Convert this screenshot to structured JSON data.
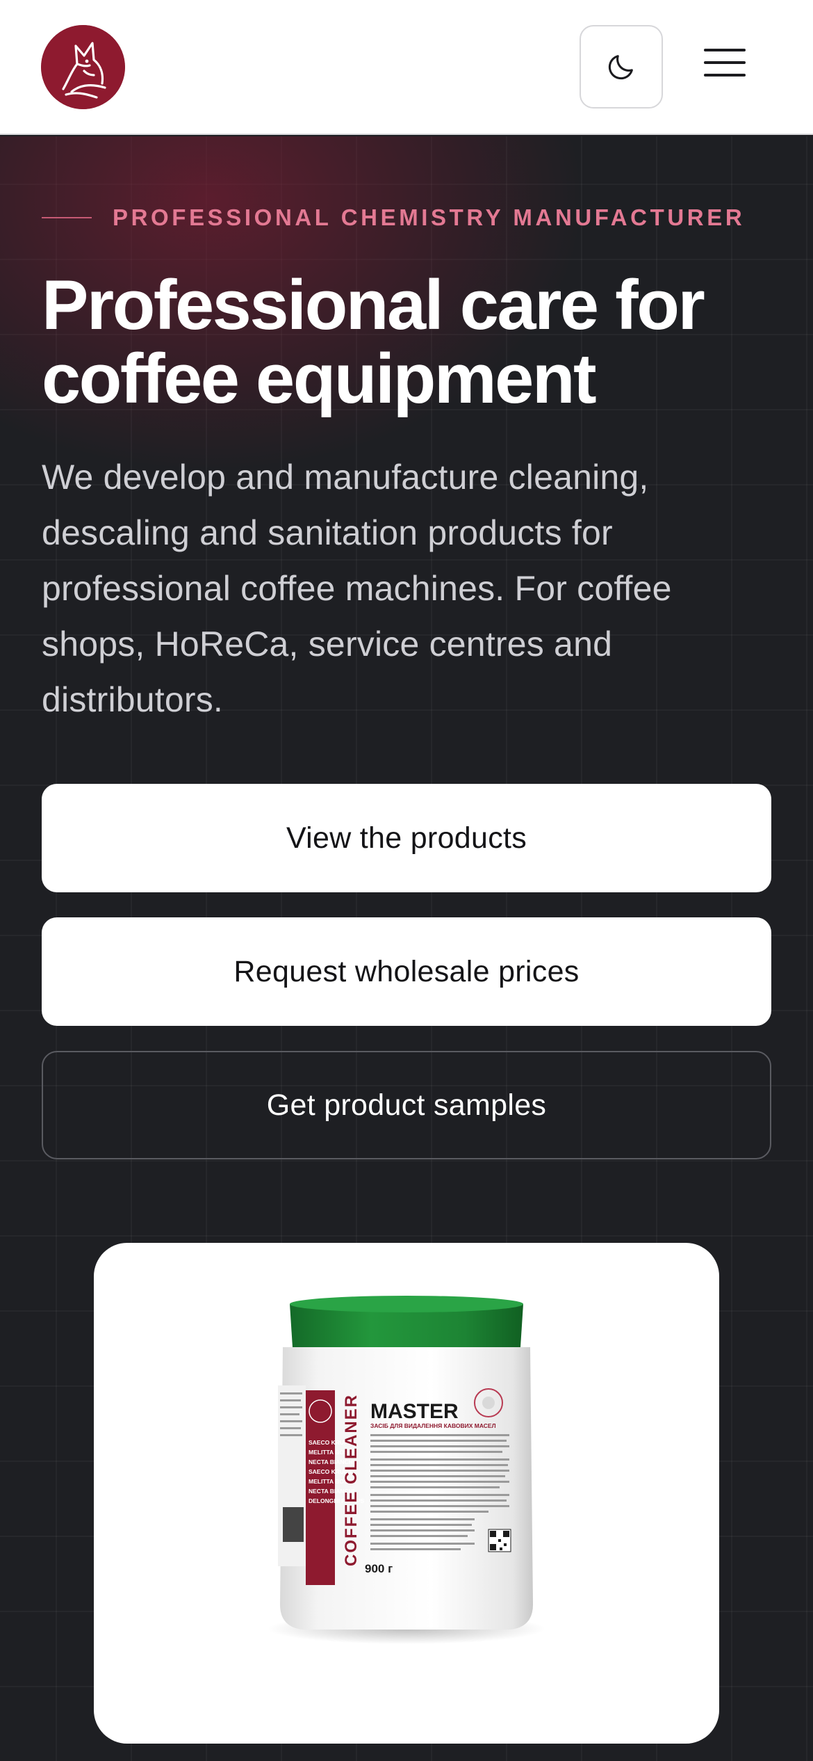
{
  "header": {
    "logo_icon": "fox-logo-icon",
    "theme_toggle_icon": "moon-icon",
    "menu_icon": "hamburger-menu-icon"
  },
  "hero": {
    "eyebrow": "PROFESSIONAL CHEMISTRY MANUFACTURER",
    "title_line1": "Professional care for",
    "title_line2": "coffee equipment",
    "lead": "We develop and manufacture cleaning, descaling and sanitation products for professional coffee machines. For coffee shops, HoReCa, service centres and distributors.",
    "buttons": {
      "view_products": "View the products",
      "wholesale": "Request wholesale prices",
      "samples": "Get product samples"
    }
  },
  "product": {
    "brand": "MASTER",
    "subtitle": "ЗАСІБ ДЛЯ ВИДАЛЕННЯ КАВОВИХ МАСЕЛ",
    "side_label": "COFFEE CLEANER",
    "weight": "900 г",
    "compat_list": [
      "SAECO KRUPS",
      "MELITTA BOSCH",
      "NECTA BIANCHI",
      "SAECO KRUPS",
      "MELITTA BOSCH",
      "NECTA BIANCHI",
      "DELONGHI PHILIPS"
    ]
  },
  "colors": {
    "brand_red": "#8e1a2f",
    "eyebrow_pink": "#e37993",
    "lid_green": "#1f8a35",
    "hero_bg": "#1e1f23"
  }
}
